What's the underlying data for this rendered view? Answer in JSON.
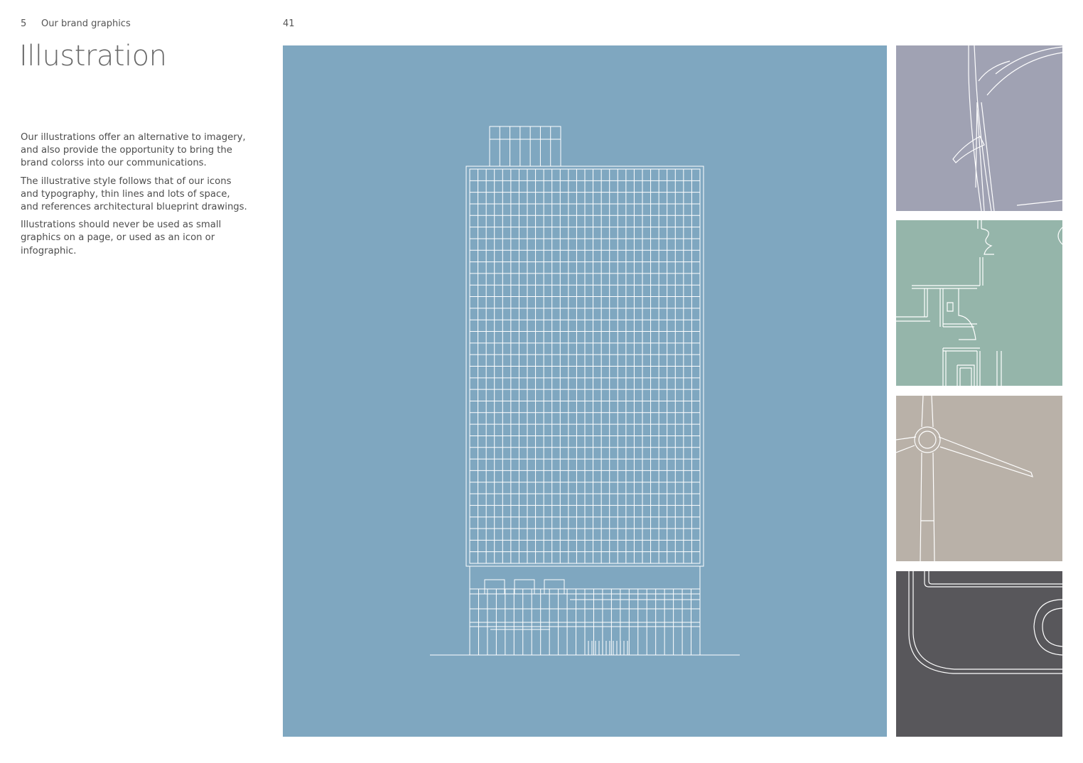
{
  "header": {
    "section_number": "5",
    "section_name": "Our brand graphics",
    "page_number": "41"
  },
  "page_title": "Illustration",
  "body": {
    "paragraphs": [
      "Our illustrations offer an alternative to imagery, and also provide the opportunity to bring the brand colorss into our communications.",
      "The illustrative style follows that of our icons and typography, thin lines and lots of space, and references architectural blueprint drawings.",
      "Illustrations should never be used as small graphics on a page, or used as an icon or infographic."
    ]
  },
  "illustrations": {
    "main": {
      "subject": "building-elevation-illustration",
      "color": "#7fa7c0"
    },
    "thumbnails": [
      {
        "subject": "architectural-detail-illustration",
        "color": "#a0a2b3"
      },
      {
        "subject": "floor-plan-illustration",
        "color": "#95b5aa"
      },
      {
        "subject": "wind-turbine-illustration",
        "color": "#b9b1a8"
      },
      {
        "subject": "device-outline-illustration",
        "color": "#58575b"
      }
    ],
    "line_color": "#ffffff"
  }
}
